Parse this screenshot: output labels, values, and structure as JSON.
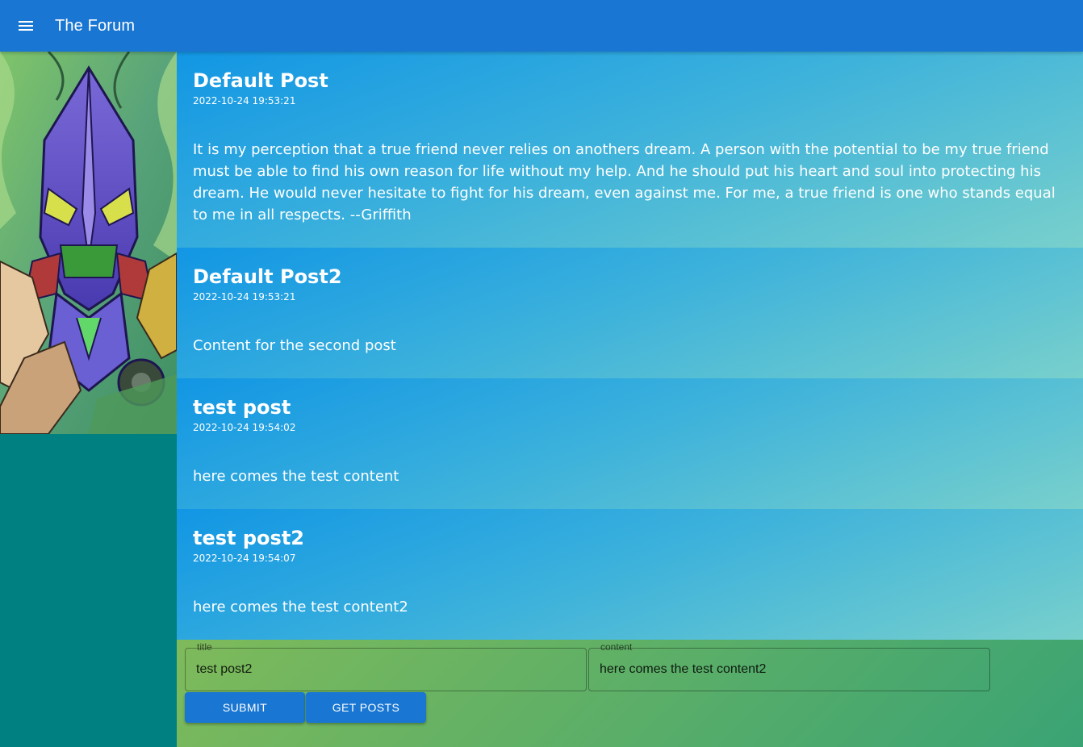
{
  "appbar": {
    "title": "The Forum",
    "menu_icon": "menu-icon",
    "color": "#1976d2"
  },
  "sidebar": {
    "image": "anime-mecha-artwork",
    "background": "#008080"
  },
  "posts": [
    {
      "title": "Default Post",
      "date": "2022-10-24 19:53:21",
      "content": "It is my perception that a true friend never relies on anothers dream. A person with the potential to be my true friend must be able to find his own reason for life without my help. And he should put his heart and soul into protecting his dream. He would never hesitate to fight for his dream, even against me. For me, a true friend is one who stands equal to me in all respects. --Griffith"
    },
    {
      "title": "Default Post2",
      "date": "2022-10-24 19:53:21",
      "content": "Content for the second post"
    },
    {
      "title": "test post",
      "date": "2022-10-24 19:54:02",
      "content": "here comes the test content"
    },
    {
      "title": "test post2",
      "date": "2022-10-24 19:54:07",
      "content": "here comes the test content2"
    }
  ],
  "form": {
    "title_label": "title",
    "title_value": "test post2",
    "content_label": "content",
    "content_value": "here comes the test content2",
    "submit_label": "SUBMIT",
    "get_posts_label": "GET POSTS"
  }
}
